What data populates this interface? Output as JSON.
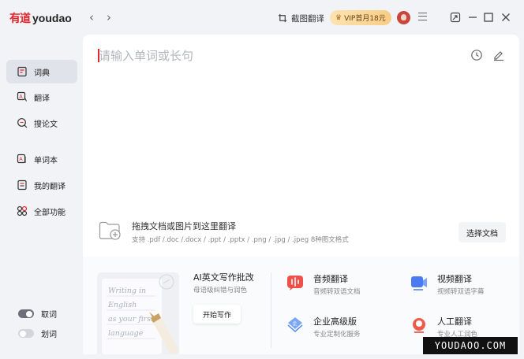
{
  "app": {
    "logo_cn": "有道",
    "logo_en": "youdao"
  },
  "topbar": {
    "back_arrow": "‹",
    "forward_arrow": "›",
    "screenshot_translate": "截图翻译",
    "vip_label": "VIP首月18元"
  },
  "sidebar": {
    "items": [
      {
        "label": "词典",
        "icon": "dictionary-icon"
      },
      {
        "label": "翻译",
        "icon": "translate-icon"
      },
      {
        "label": "搜论文",
        "icon": "paper-search-icon"
      },
      {
        "label": "单词本",
        "icon": "wordbook-icon"
      },
      {
        "label": "我的翻译",
        "icon": "my-translation-icon"
      },
      {
        "label": "全部功能",
        "icon": "all-features-icon"
      }
    ],
    "toggles": [
      {
        "label": "取词",
        "on": true
      },
      {
        "label": "划词",
        "on": false
      }
    ]
  },
  "search": {
    "placeholder": "请输入单词或长句"
  },
  "upload": {
    "title": "拖拽文档或图片到这里翻译",
    "formats": "支持 .pdf /.doc /.docx / .ppt / .pptx / .png / .jpg / .jpeg 8种图文格式",
    "choose_button": "选择文档"
  },
  "ai_writing": {
    "title": "AI英文写作批改",
    "subtitle": "母语级纠错与润色",
    "button": "开始写作",
    "card_text": [
      "Writing in",
      "English",
      "as your first",
      "language"
    ]
  },
  "features": [
    {
      "title": "音频翻译",
      "subtitle": "音频转双语文档",
      "icon": "audio-translate-icon",
      "color": "#f0504a"
    },
    {
      "title": "视频翻译",
      "subtitle": "视频转双语字幕",
      "icon": "video-translate-icon",
      "color": "#4a7bf0"
    },
    {
      "title": "企业高级版",
      "subtitle": "专业定制化服务",
      "icon": "enterprise-icon",
      "color": "#4a8bf5"
    },
    {
      "title": "人工翻译",
      "subtitle": "专业人工润色",
      "icon": "human-translate-icon",
      "color": "#f05a4a"
    }
  ],
  "watermark": "YOUDAOO.COM",
  "colors": {
    "brand": "#e3262c",
    "vip_bg": "#f8cd84"
  }
}
